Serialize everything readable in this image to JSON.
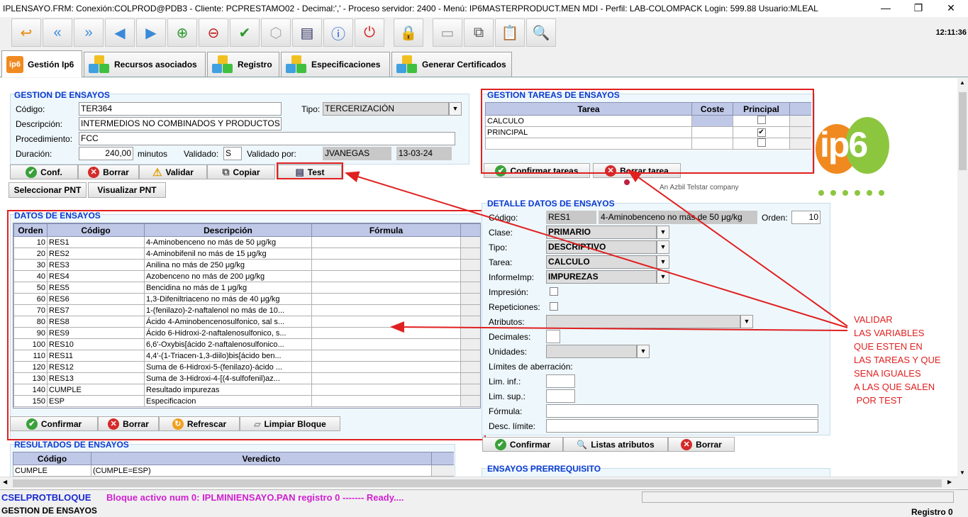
{
  "window": {
    "title": "IPLENSAYO.FRM:    Conexión:COLPROD@PDB3 - Cliente: PCPRESTAMO02 - Decimal:',' - Proceso servidor: 2400 - Menú: IP6MASTERPRODUCT.MEN MDI - Perfil: LAB-COLOMPACK Login: 599.88     Usuario:MLEAL",
    "clock": "12:11:36"
  },
  "toolbar": {
    "icons": [
      "exit-icon",
      "first-icon",
      "previous-icon",
      "next-icon",
      "last-icon",
      "add-record-icon",
      "delete-record-icon",
      "accept-icon",
      "cube-icon",
      "print-icon",
      "info-icon",
      "power-icon",
      "lock-icon",
      "blank-icon",
      "copy-icon",
      "paste-icon",
      "search-icon"
    ]
  },
  "tabs": [
    {
      "label": "Gestión Ip6"
    },
    {
      "label": "Recursos asociados"
    },
    {
      "label": "Registro"
    },
    {
      "label": "Especificaciones"
    },
    {
      "label": "Generar Certificados"
    }
  ],
  "gestion": {
    "title": "GESTION DE ENSAYOS",
    "codigo_label": "Código:",
    "codigo": "TER364",
    "tipo_label": "Tipo:",
    "tipo": "TERCERIZACIÓN",
    "descripcion_label": "Descripción:",
    "descripcion": "INTERMEDIOS NO COMBINADOS Y PRODUCTOS DE",
    "procedimiento_label": "Procedimiento:",
    "procedimiento": "FCC",
    "duracion_label": "Duración:",
    "duracion": "240,00",
    "minutos_label": "minutos",
    "validado_label": "Validado:",
    "validado": "S",
    "validado_por_label": "Validado por:",
    "validado_por": "JVANEGAS",
    "fecha": "13-03-24"
  },
  "gestion_buttons": {
    "conf": "Conf.",
    "borrar": "Borrar",
    "validar": "Validar",
    "copiar": "Copiar",
    "test": "Test",
    "sel_pnt": "Seleccionar PNT",
    "vis_pnt": "Visualizar PNT"
  },
  "datos": {
    "title": "DATOS DE ENSAYOS",
    "headers": [
      "Orden",
      "Código",
      "Descripción",
      "Fórmula"
    ],
    "rows": [
      [
        "10",
        "RES1",
        "4-Aminobenceno no más de 50 μg/kg",
        ""
      ],
      [
        "20",
        "RES2",
        "4-Aminobifenil no más de 15 μg/kg",
        ""
      ],
      [
        "30",
        "RES3",
        "Anilina no más de 250 μg/kg",
        ""
      ],
      [
        "40",
        "RES4",
        "Azobenceno no más de 200 μg/kg",
        ""
      ],
      [
        "50",
        "RES5",
        "Bencidina no más de 1 μg/kg",
        ""
      ],
      [
        "60",
        "RES6",
        "1,3-Difeniltriaceno no más de 40 μg/kg",
        ""
      ],
      [
        "70",
        "RES7",
        "1-(fenilazo)-2-naftalenol no más de 10...",
        ""
      ],
      [
        "80",
        "RES8",
        "Ácido 4-Aminobencenosulfonico, sal s...",
        ""
      ],
      [
        "90",
        "RES9",
        "Ácido 6-Hidroxi-2-naftalenosulfonico, s...",
        ""
      ],
      [
        "100",
        "RES10",
        "6,6'-Oxybis[ácido 2-naftalenosulfonico...",
        ""
      ],
      [
        "110",
        "RES11",
        "4,4'-(1-Triacen-1,3-diilo)bis[ácido ben...",
        ""
      ],
      [
        "120",
        "RES12",
        "Suma de 6-Hidroxi-5-(fenilazo)-ácido ...",
        ""
      ],
      [
        "130",
        "RES13",
        "Suma de 3-Hidroxi-4-[(4-sulfofenil)az...",
        ""
      ],
      [
        "140",
        "CUMPLE",
        "Resultado impurezas",
        ""
      ],
      [
        "150",
        "ESP",
        "Especificacion",
        ""
      ]
    ],
    "buttons": {
      "confirmar": "Confirmar",
      "borrar": "Borrar",
      "refrescar": "Refrescar",
      "limpiar": "Limpiar Bloque"
    }
  },
  "resultados": {
    "title": "RESULTADOS DE ENSAYOS",
    "headers": [
      "Código",
      "Veredicto"
    ],
    "rows": [
      [
        "CUMPLE",
        "(CUMPLE=ESP)"
      ]
    ]
  },
  "tareas": {
    "title": "GESTION TAREAS DE ENSAYOS",
    "headers": [
      "Tarea",
      "Coste",
      "Principal"
    ],
    "rows": [
      {
        "tarea": "CALCULO",
        "coste": "",
        "principal": ""
      },
      {
        "tarea": "PRINCIPAL",
        "coste": "",
        "principal": "✔"
      },
      {
        "tarea": "",
        "coste": "",
        "principal": ""
      }
    ],
    "confirmar": "Confirmar tareas",
    "borrar": "Borrar tarea"
  },
  "logo": {
    "text": "ip6",
    "tagline": "An Azbil Telstar company"
  },
  "detalle": {
    "title": "DETALLE DATOS DE ENSAYOS",
    "codigo_label": "Código:",
    "codigo": "RES1",
    "codigo_desc": "4-Aminobenceno no más de 50 μg/kg",
    "orden_label": "Orden:",
    "orden": "10",
    "clase_label": "Clase:",
    "clase": "PRIMARIO",
    "tipo_label": "Tipo:",
    "tipo": "DESCRIPTIVO",
    "tarea_label": "Tarea:",
    "tarea": "CALCULO",
    "informe_label": "InformeImp:",
    "informe": "IMPUREZAS",
    "impresion_label": "Impresión:",
    "repeticiones_label": "Repeticiones:",
    "atributos_label": "Atributos:",
    "decimales_label": "Decimales:",
    "unidades_label": "Unidades:",
    "limites_label": "Límites de aberración:",
    "liminf_label": "Lim. inf.:",
    "limsup_label": "Lim. sup.:",
    "formula_label": "Fórmula:",
    "desc_limite_label": "Desc. límite:",
    "confirmar": "Confirmar",
    "listas": "Listas atributos",
    "borrar": "Borrar"
  },
  "prerreq": {
    "title": "ENSAYOS PRERREQUISITO"
  },
  "annotation": {
    "lines": [
      "VALIDAR",
      "LAS VARIABLES",
      "QUE ESTEN EN",
      "LAS TAREAS Y QUE",
      "SENA IGUALES",
      "A LAS QUE SALEN",
      " POR TEST"
    ],
    "color": "#e02020"
  },
  "status": {
    "block": "CSELPROTBLOQUE",
    "message": "Bloque activo num 0: IPLMINIENSAYO.PAN  registro 0 ------- Ready....",
    "form": "GESTION DE ENSAYOS",
    "registro": "Registro 0"
  }
}
